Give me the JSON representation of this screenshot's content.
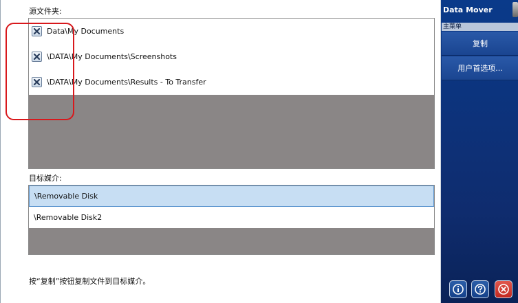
{
  "source": {
    "label": "源文件夹:",
    "folders": [
      {
        "path": "Data\\My Documents"
      },
      {
        "path": "\\DATA\\My Documents\\Screenshots"
      },
      {
        "path": "\\DATA\\My Documents\\Results - To Transfer"
      }
    ]
  },
  "destination": {
    "label": "目标媒介:",
    "media": [
      {
        "name": "\\Removable Disk",
        "selected": true
      },
      {
        "name": "\\Removable Disk2",
        "selected": false
      }
    ]
  },
  "status_text": "按“复制”按钮复制文件到目标媒介。",
  "sidebar": {
    "title": "Data Mover",
    "menu_header": "主菜单",
    "copy_label": "复制",
    "prefs_label": "用户首选项..."
  },
  "bottom_icons": [
    "info-icon",
    "help-icon",
    "close-icon"
  ],
  "colors": {
    "sidebar": "#0f2c6e",
    "selection": "#c7def3",
    "highlight": "#d8181c"
  }
}
